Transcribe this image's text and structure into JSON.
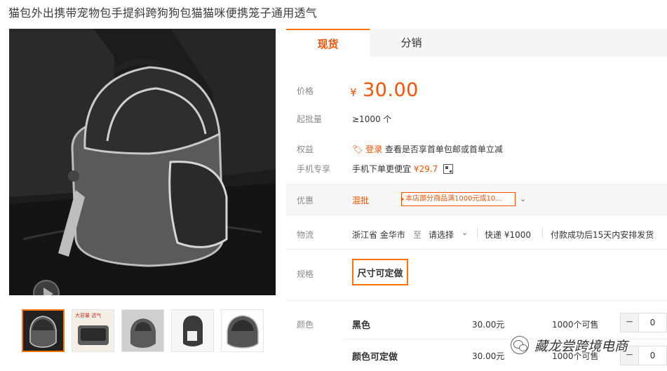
{
  "product": {
    "title": "猫包外出携带宠物包手提斜跨狗狗包猫猫咪便携笼子通用透气"
  },
  "gallery": {
    "zoom_icon": "magnifier-icon",
    "play_icon": "play-icon",
    "thumbs": [
      {
        "label": ""
      },
      {
        "label": "大容量 透气"
      },
      {
        "label": ""
      },
      {
        "label": ""
      },
      {
        "label": ""
      }
    ]
  },
  "tabs": [
    {
      "label": "现货",
      "active": true
    },
    {
      "label": "分销",
      "active": false
    }
  ],
  "price": {
    "label": "价格",
    "currency": "¥",
    "value": "30.00"
  },
  "moq": {
    "label": "起批量",
    "value": "≥1000 个"
  },
  "benefits": {
    "label": "权益",
    "login_label": "登录",
    "text": "查看是否享首单包邮或首单立减"
  },
  "mobile": {
    "label": "手机专享",
    "text": "手机下单更便宜",
    "price": "¥29.7",
    "qr_icon": "qr-code-icon"
  },
  "promo": {
    "label": "优惠",
    "type": "混批",
    "tag": "本店部分商品满1000元或10..."
  },
  "logistics": {
    "label": "物流",
    "from": "浙江省 金华市",
    "to_label": "至",
    "destination": "请选择",
    "express": "快递 ¥1000",
    "delivery": "付款成功后15天内安排发货"
  },
  "spec": {
    "label": "规格",
    "options": [
      "尺寸可定做"
    ]
  },
  "colors": {
    "label": "颜色",
    "rows": [
      {
        "name": "黑色",
        "price": "30.00元",
        "stock": "1000个可售",
        "qty": "0"
      },
      {
        "name": "颜色可定做",
        "price": "30.00元",
        "stock": "1000个可售",
        "qty": "0"
      }
    ]
  },
  "watermark": {
    "text": "藏龙尝跨境电商"
  },
  "theme": {
    "accent": "#ff5000",
    "tab_accent": "#ff7300"
  }
}
